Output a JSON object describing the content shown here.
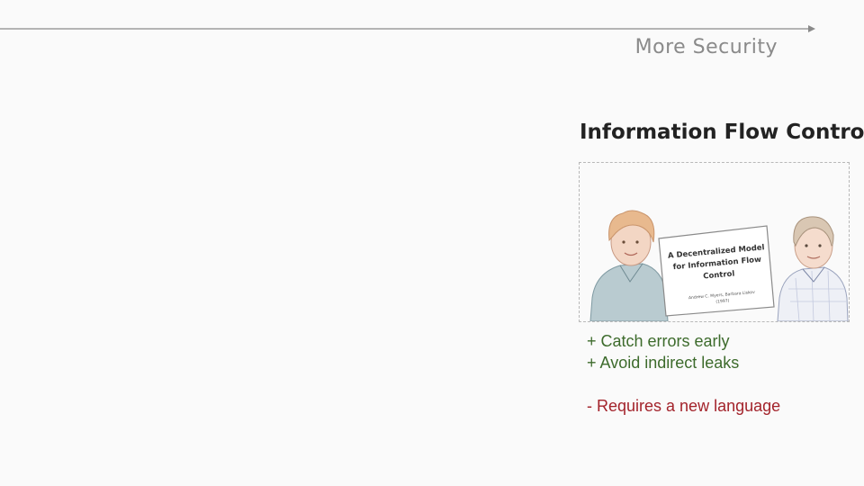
{
  "axis": {
    "label": "More Security"
  },
  "section": {
    "title": "Information Flow Control"
  },
  "figure": {
    "paper_title_lines": [
      "A Decentralized Model",
      "for Information Flow",
      "Control"
    ],
    "paper_authors": "Andrew C. Myers, Barbara Liskov",
    "paper_year": "(1997)"
  },
  "pros": [
    "+ Catch errors early",
    "+ Avoid indirect leaks"
  ],
  "cons": [
    "-  Requires a new language"
  ],
  "colors": {
    "pro": "#3d6b2c",
    "con": "#a3232b",
    "axis": "#8a8a8a"
  }
}
